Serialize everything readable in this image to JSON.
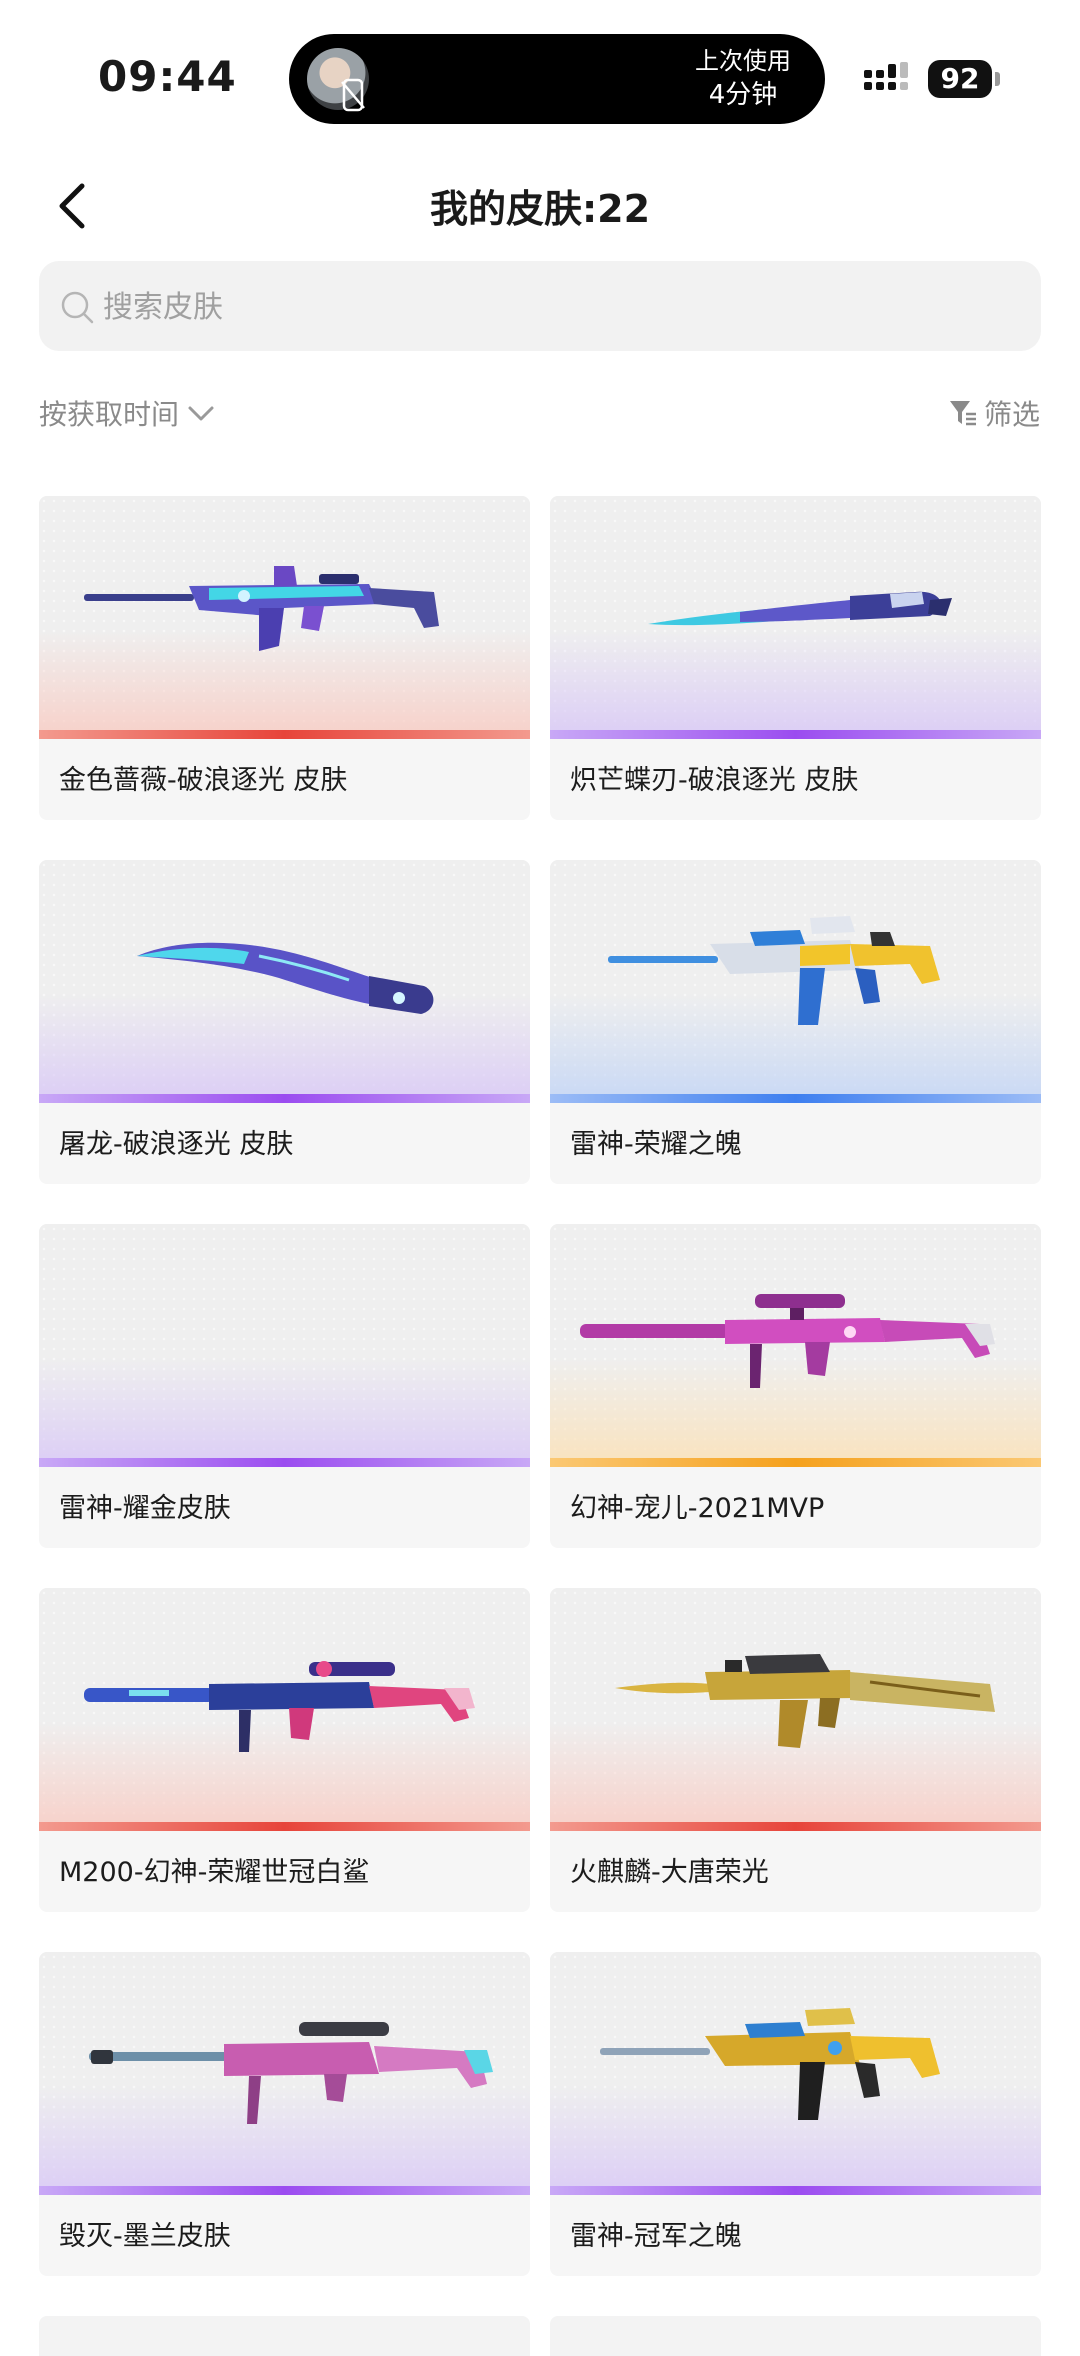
{
  "status_bar": {
    "time": "09:44",
    "island_line1": "上次使用",
    "island_line2": "4分钟",
    "battery": "92"
  },
  "header": {
    "title": "我的皮肤:22"
  },
  "search": {
    "placeholder": "搜索皮肤"
  },
  "sort": {
    "label": "按获取时间"
  },
  "filter": {
    "label": "筛选"
  },
  "skins": [
    {
      "name": "金色蔷薇-破浪逐光 皮肤",
      "rarity": "red",
      "weapon_icon": "assault-rifle-icon"
    },
    {
      "name": "炽芒蝶刃-破浪逐光 皮肤",
      "rarity": "purple",
      "weapon_icon": "blade-icon"
    },
    {
      "name": "屠龙-破浪逐光 皮肤",
      "rarity": "purple",
      "weapon_icon": "machete-icon"
    },
    {
      "name": "雷神-荣耀之魄",
      "rarity": "blue",
      "weapon_icon": "carbine-rifle-icon"
    },
    {
      "name": "雷神-耀金皮肤",
      "rarity": "purple",
      "weapon_icon": ""
    },
    {
      "name": "幻神-宠儿-2021MVP",
      "rarity": "gold",
      "weapon_icon": "sniper-rifle-icon"
    },
    {
      "name": "M200-幻神-荣耀世冠白鲨",
      "rarity": "red",
      "weapon_icon": "sniper-rifle-icon"
    },
    {
      "name": "火麒麟-大唐荣光",
      "rarity": "red",
      "weapon_icon": "ak-rifle-icon"
    },
    {
      "name": "毁灭-墨兰皮肤",
      "rarity": "purple",
      "weapon_icon": "heavy-sniper-icon"
    },
    {
      "name": "雷神-冠军之魄",
      "rarity": "purple",
      "weapon_icon": "carbine-rifle-icon"
    }
  ],
  "colors": {
    "rarity_red": "#e7443a",
    "rarity_purple": "#9b4cf0",
    "rarity_blue": "#3e7ff0",
    "rarity_gold": "#f5a11d"
  }
}
